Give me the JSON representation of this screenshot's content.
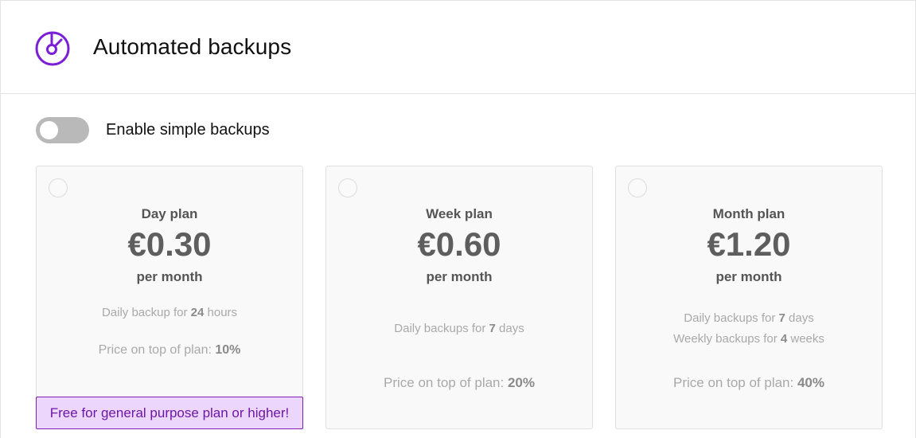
{
  "header": {
    "title": "Automated backups",
    "icon": "backup-gauge-icon",
    "accent_color": "#7a1fd6"
  },
  "toggle": {
    "label": "Enable simple backups",
    "enabled": false
  },
  "plans": [
    {
      "name": "Day plan",
      "price": "€0.30",
      "period": "per month",
      "lines": [
        {
          "prefix": "Daily backup for ",
          "value": "24",
          "suffix": " hours"
        }
      ],
      "price_note": {
        "prefix": "Price on top of plan: ",
        "value": "10%"
      }
    },
    {
      "name": "Week plan",
      "price": "€0.60",
      "period": "per month",
      "lines": [
        {
          "prefix": "Daily backups for ",
          "value": "7",
          "suffix": " days"
        }
      ],
      "price_note": {
        "prefix": "Price on top of plan: ",
        "value": "20%"
      }
    },
    {
      "name": "Month plan",
      "price": "€1.20",
      "period": "per month",
      "lines": [
        {
          "prefix": "Daily backups for ",
          "value": "7",
          "suffix": " days"
        },
        {
          "prefix": "Weekly backups for ",
          "value": "4",
          "suffix": " weeks"
        }
      ],
      "price_note": {
        "prefix": "Price on top of plan: ",
        "value": "40%"
      }
    }
  ],
  "free_banner": {
    "text": "Free for general purpose plan or higher!",
    "background": "#ecd6fb",
    "border": "#7e1fb7"
  }
}
